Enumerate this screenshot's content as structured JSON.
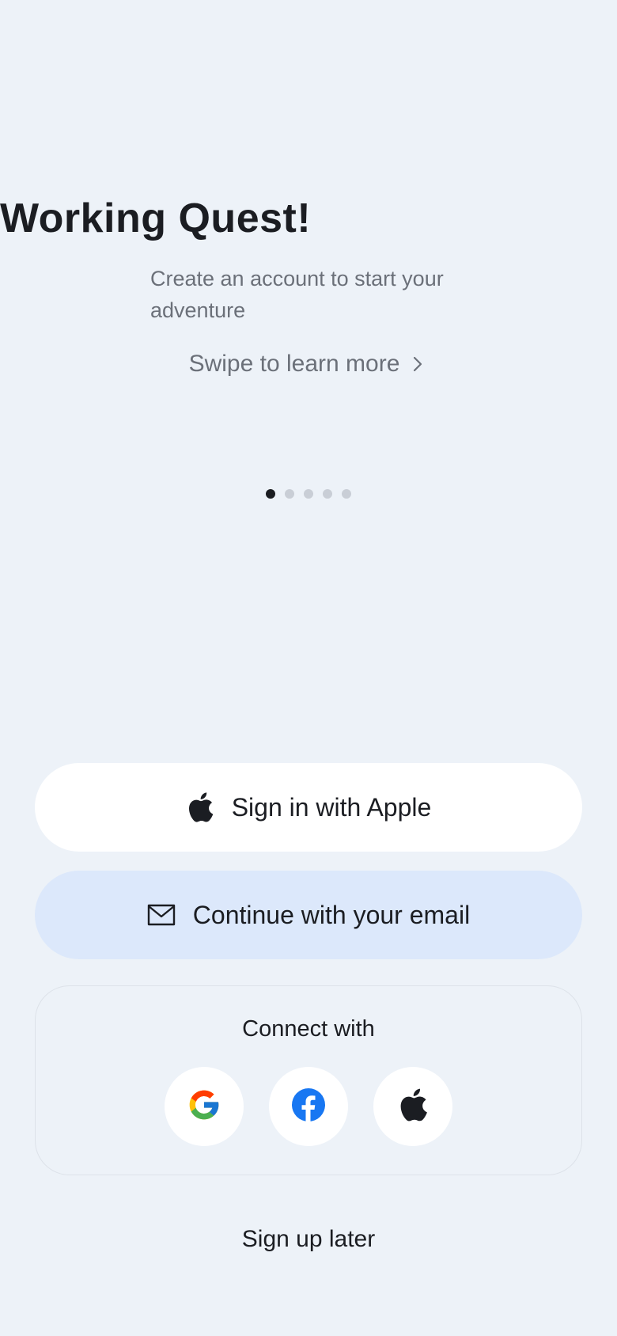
{
  "hero": {
    "title": "Working Quest!",
    "subtitle": "Create an account to start your adventure",
    "swipe_text": "Swipe to learn more",
    "swipe_icon": "chevron-right-icon"
  },
  "pager": {
    "total": 5,
    "active_index": 0
  },
  "auth": {
    "apple_label": "Sign in with Apple",
    "apple_icon": "apple-icon",
    "email_label": "Continue with your email",
    "email_icon": "envelope-icon"
  },
  "connect": {
    "label": "Connect with",
    "providers": [
      "google-icon",
      "facebook-icon",
      "apple-icon"
    ]
  },
  "footer": {
    "later_label": "Sign up later"
  },
  "colors": {
    "background": "#edf2f8",
    "email_button": "#dce8fb",
    "text_primary": "#1b1d22",
    "text_secondary": "#6b7079",
    "dot_active": "#1b1d22",
    "dot_inactive": "#c9ced6",
    "facebook_blue": "#1877f2"
  }
}
